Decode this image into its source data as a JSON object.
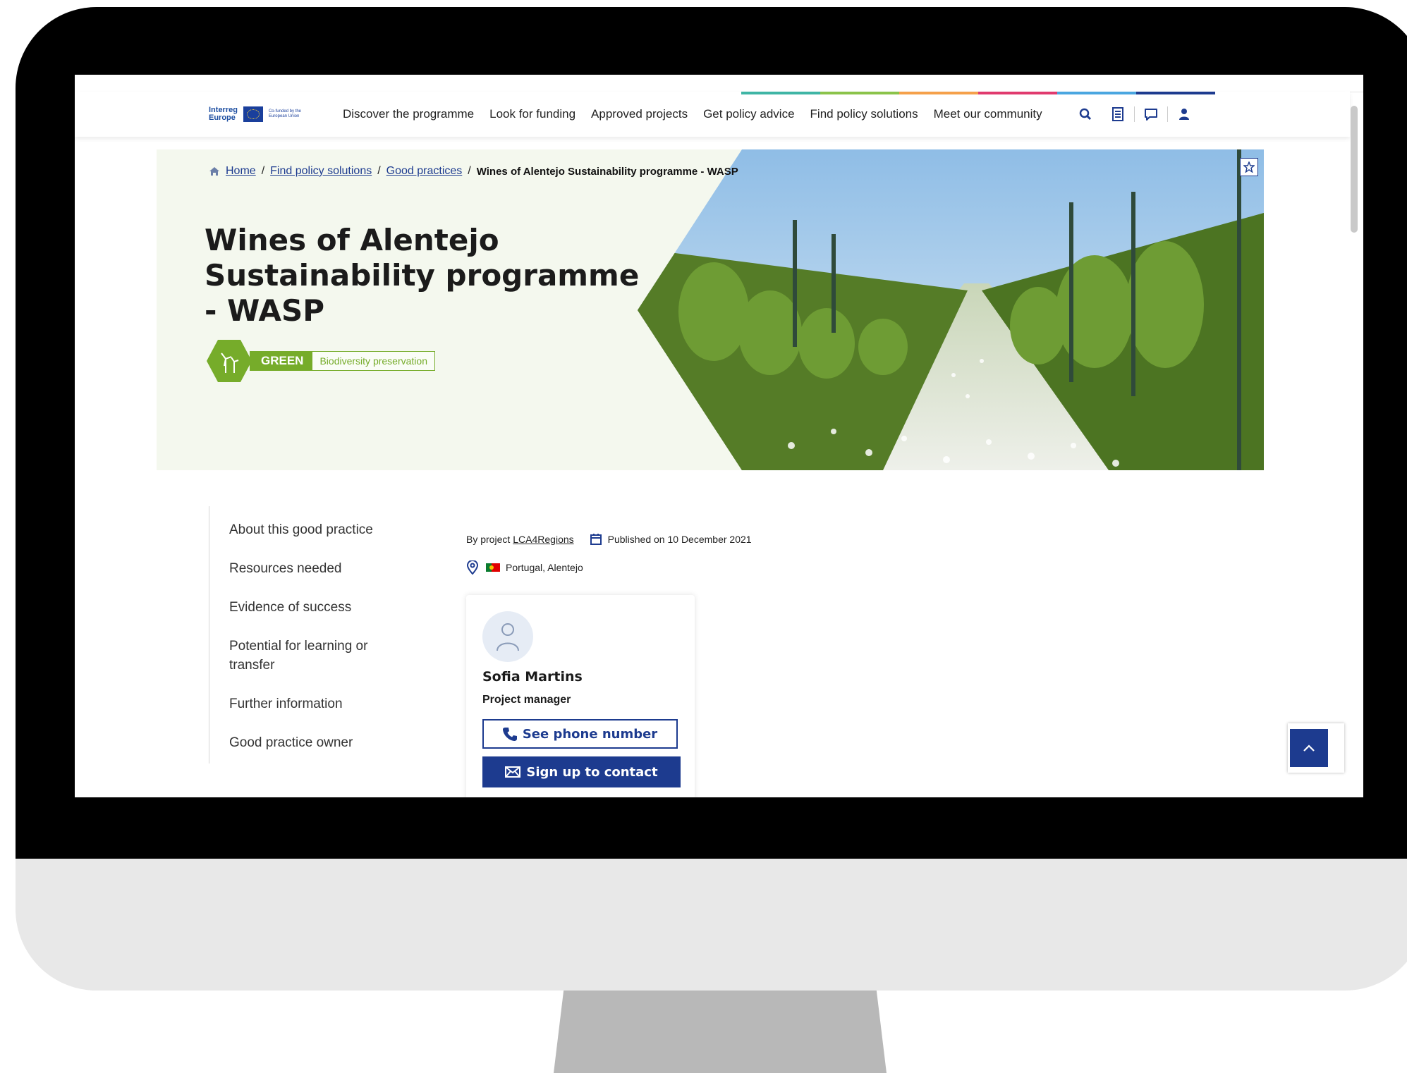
{
  "nav": {
    "logo": {
      "line1": "Interreg",
      "line2": "Europe",
      "eu_text": "Co-funded by the European Union"
    },
    "items": [
      {
        "label": "Discover the programme"
      },
      {
        "label": "Look for funding"
      },
      {
        "label": "Approved projects"
      },
      {
        "label": "Get policy advice"
      },
      {
        "label": "Find policy solutions"
      },
      {
        "label": "Meet our community"
      }
    ],
    "icons": [
      "search-icon",
      "newsletter-icon",
      "chat-icon",
      "user-icon"
    ],
    "stripe_colors": [
      "#3fb5a5",
      "#8bc34a",
      "#f5a04a",
      "#e03a6e",
      "#4aa6e0",
      "#1d3b8f"
    ]
  },
  "breadcrumb": {
    "home": "Home",
    "level1": "Find policy solutions",
    "level2": "Good practices ",
    "current": "Wines of Alentejo Sustainability programme - WASP",
    "separator": "/"
  },
  "page": {
    "title": "Wines of Alentejo Sustainability programme - WASP",
    "tag_category": "GREEN",
    "tag_theme": "Biodiversity preservation"
  },
  "sidenav": {
    "items": [
      {
        "label": "About this good practice"
      },
      {
        "label": "Resources needed"
      },
      {
        "label": "Evidence of success"
      },
      {
        "label": "Potential for learning or transfer"
      },
      {
        "label": "Further information"
      },
      {
        "label": "Good practice owner"
      }
    ]
  },
  "meta": {
    "by_project_label": "By project",
    "project_name": "LCA4Regions",
    "published": "Published on 10 December 2021",
    "location": "Portugal, Alentejo"
  },
  "contact": {
    "name": "Sofia Martins",
    "role": "Project manager",
    "phone_button": "See phone number",
    "signup_button": "Sign up to contact"
  },
  "colors": {
    "brand_blue": "#1d3b8f",
    "green": "#76ac2a",
    "hero_bg": "#f4f8ee"
  }
}
